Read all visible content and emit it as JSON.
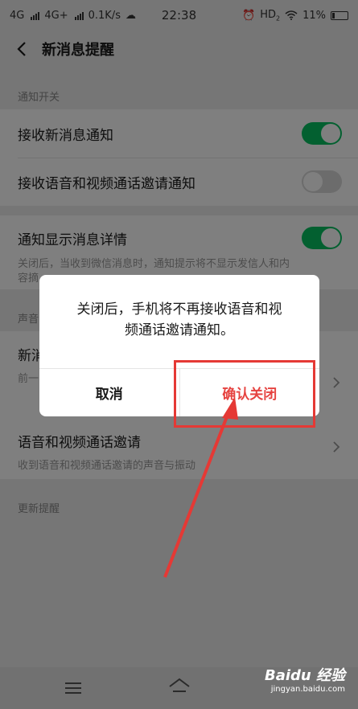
{
  "status_bar": {
    "network_1": "4G",
    "network_2": "4G+",
    "speed": "0.1K/s",
    "time": "22:38",
    "hd_label": "HD",
    "hd_sub": "2",
    "battery": "11%"
  },
  "header": {
    "title": "新消息提醒"
  },
  "sections": {
    "notification_switch_label": "通知开关",
    "sound_label": "声音",
    "update_label": "更新提醒"
  },
  "rows": {
    "receive_new": "接收新消息通知",
    "receive_voice_video": "接收语音和视频通话邀请通知",
    "show_details": "通知显示消息详情",
    "show_details_desc_1": "关闭后，当收到微信消息时，通知提示将不显示发信人和内",
    "show_details_desc_2": "容摘",
    "new_message_partial": "新消",
    "new_message_sub_partial": "前一",
    "voice_video_invite": "语音和视频通话邀请",
    "voice_video_invite_desc": "收到语音和视频通话邀请的声音与振动"
  },
  "toggles": {
    "receive_new": true,
    "receive_voice_video": false,
    "show_details": true
  },
  "dialog": {
    "message_line_1": "关闭后，手机将不再接收语音和视",
    "message_line_2": "频通话邀请通知。",
    "cancel_label": "取消",
    "confirm_label": "确认关闭"
  },
  "watermark": {
    "brand": "Baidu 经验",
    "url": "jingyan.baidu.com"
  },
  "colors": {
    "accent_green": "#07c160",
    "confirm_red": "#e64340",
    "highlight_red": "#e53935"
  }
}
